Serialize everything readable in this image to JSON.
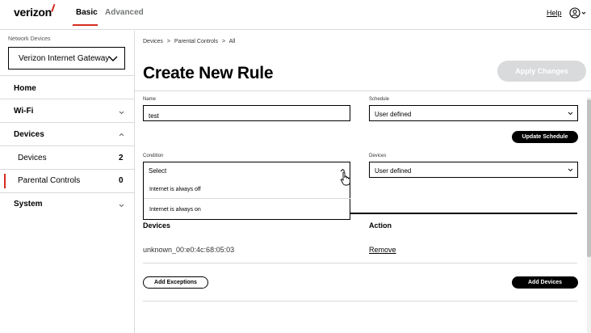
{
  "brand": {
    "logo_text": "verizon"
  },
  "topnav": {
    "tabs": [
      {
        "label": "Basic",
        "active": true
      },
      {
        "label": "Advanced",
        "active": false
      }
    ],
    "help_label": "Help",
    "user_icon": "user-icon"
  },
  "sidebar": {
    "network_devices_label": "Network Devices",
    "gateway_select_value": "Verizon Internet Gateway",
    "items": [
      {
        "label": "Home"
      },
      {
        "label": "Wi-Fi"
      },
      {
        "label": "Devices"
      },
      {
        "label": "Devices",
        "count": "2"
      },
      {
        "label": "Parental Controls",
        "count": "0"
      },
      {
        "label": "System"
      }
    ]
  },
  "breadcrumb": {
    "part1": "Devices",
    "sep": ">",
    "part2": "Parental Controls",
    "part3": "All"
  },
  "page_title": "Create New Rule",
  "apply_button": "Apply Changes",
  "form": {
    "name_label": "Name",
    "name_value": "test",
    "schedule_label": "Schedule",
    "schedule_value": "User defined",
    "update_schedule_button": "Update Schedule",
    "condition_label": "Condition",
    "condition_value": "Select",
    "condition_options": [
      "Internet is always off",
      "Internet is always on"
    ],
    "devices_label": "Devices",
    "devices_value": "User defined"
  },
  "table": {
    "headers": {
      "devices": "Devices",
      "action": "Action"
    },
    "rows": [
      {
        "device": "unknown_00:e0:4c:68:05:03",
        "action": "Remove"
      }
    ]
  },
  "buttons": {
    "add_exceptions": "Add Exceptions",
    "add_devices": "Add Devices"
  },
  "colors": {
    "accent": "#d52b1e",
    "disabled": "#d8dadb"
  }
}
